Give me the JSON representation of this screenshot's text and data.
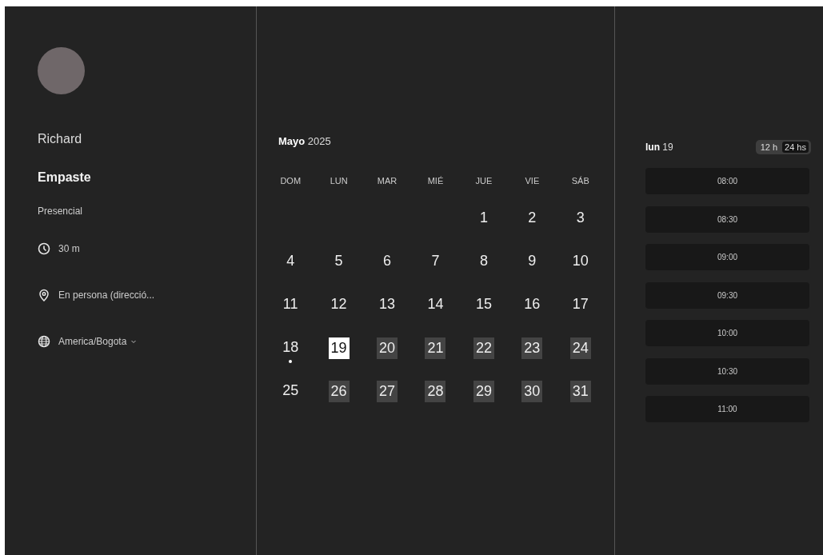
{
  "host": {
    "name": "Richard"
  },
  "event": {
    "title": "Empaste",
    "mode": "Presencial",
    "details": [
      {
        "kind": "clock",
        "text": "30 m"
      },
      {
        "kind": "pin",
        "text": "En persona (direcció..."
      },
      {
        "kind": "globe",
        "text": "America/Bogota",
        "dropdown": true
      }
    ]
  },
  "calendar": {
    "month": "Mayo",
    "year": "2025",
    "weekdays": [
      "DOM",
      "LUN",
      "MAR",
      "MIÉ",
      "JUE",
      "VIE",
      "SÁB"
    ],
    "weeks": [
      [
        {
          "day": "1",
          "available": false,
          "selected": false,
          "today": false
        },
        {
          "day": "2",
          "available": false,
          "selected": false,
          "today": false
        },
        {
          "day": "3",
          "available": false,
          "selected": false,
          "today": false
        }
      ],
      [
        {
          "day": "4",
          "available": false,
          "selected": false,
          "today": false
        },
        {
          "day": "5",
          "available": false,
          "selected": false,
          "today": false
        },
        {
          "day": "6",
          "available": false,
          "selected": false,
          "today": false
        },
        {
          "day": "7",
          "available": false,
          "selected": false,
          "today": false
        },
        {
          "day": "8",
          "available": false,
          "selected": false,
          "today": false
        },
        {
          "day": "9",
          "available": false,
          "selected": false,
          "today": false
        },
        {
          "day": "10",
          "available": false,
          "selected": false,
          "today": false
        }
      ],
      [
        {
          "day": "11",
          "available": false,
          "selected": false,
          "today": false
        },
        {
          "day": "12",
          "available": false,
          "selected": false,
          "today": false
        },
        {
          "day": "13",
          "available": false,
          "selected": false,
          "today": false
        },
        {
          "day": "14",
          "available": false,
          "selected": false,
          "today": false
        },
        {
          "day": "15",
          "available": false,
          "selected": false,
          "today": false
        },
        {
          "day": "16",
          "available": false,
          "selected": false,
          "today": false
        },
        {
          "day": "17",
          "available": false,
          "selected": false,
          "today": false
        }
      ],
      [
        {
          "day": "18",
          "available": false,
          "selected": false,
          "today": true
        },
        {
          "day": "19",
          "available": true,
          "selected": true,
          "today": false
        },
        {
          "day": "20",
          "available": true,
          "selected": false,
          "today": false
        },
        {
          "day": "21",
          "available": true,
          "selected": false,
          "today": false
        },
        {
          "day": "22",
          "available": true,
          "selected": false,
          "today": false
        },
        {
          "day": "23",
          "available": true,
          "selected": false,
          "today": false
        },
        {
          "day": "24",
          "available": true,
          "selected": false,
          "today": false
        }
      ],
      [
        {
          "day": "25",
          "available": false,
          "selected": false,
          "today": false
        },
        {
          "day": "26",
          "available": true,
          "selected": false,
          "today": false
        },
        {
          "day": "27",
          "available": true,
          "selected": false,
          "today": false
        },
        {
          "day": "28",
          "available": true,
          "selected": false,
          "today": false
        },
        {
          "day": "29",
          "available": true,
          "selected": false,
          "today": false
        },
        {
          "day": "30",
          "available": true,
          "selected": false,
          "today": false
        },
        {
          "day": "31",
          "available": true,
          "selected": false,
          "today": false
        }
      ]
    ]
  },
  "slots": {
    "weekday": "lun",
    "day": "19",
    "formats": [
      {
        "label": "12 h",
        "selected": false
      },
      {
        "label": "24 hs",
        "selected": true
      }
    ],
    "times": [
      "08:00",
      "08:30",
      "09:00",
      "09:30",
      "10:00",
      "10:30",
      "11:00"
    ]
  }
}
